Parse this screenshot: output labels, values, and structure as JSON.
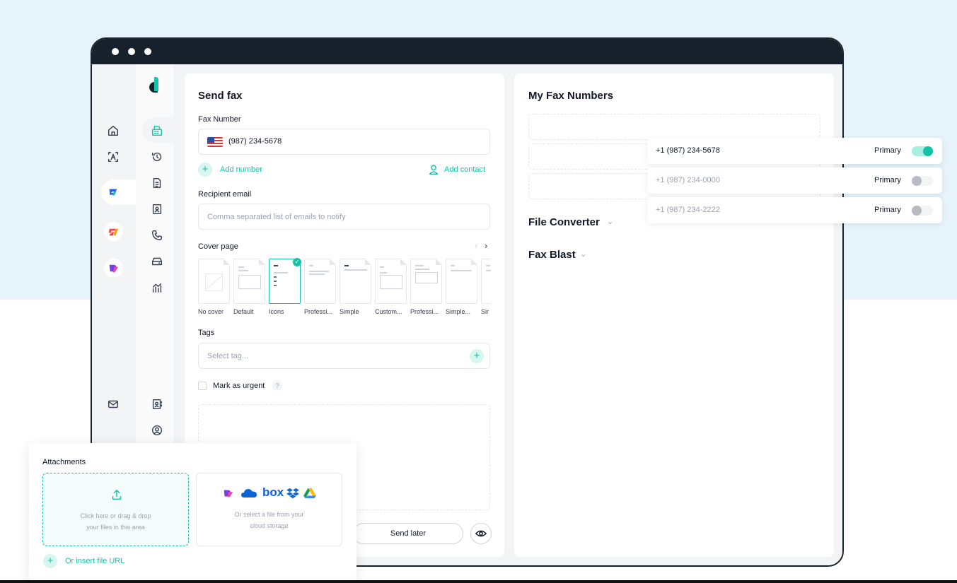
{
  "colors": {
    "accent": "#14c3a7",
    "frame": "#17212b",
    "background": "#e6f3fb"
  },
  "sidebar": {
    "rail1_icons": [
      "home-icon",
      "text-scan-icon",
      "fax-app-icon",
      "signature-app-icon",
      "docs-app-icon",
      "mail-icon"
    ],
    "rail2_icons": [
      "fax-machine-icon",
      "history-icon",
      "document-icon",
      "contact-card-icon",
      "phone-icon",
      "inbox-icon",
      "analytics-icon",
      "address-book-icon",
      "account-icon"
    ]
  },
  "send_fax": {
    "title": "Send fax",
    "fax_number_label": "Fax Number",
    "fax_number_value": "(987) 234-5678",
    "add_number": "Add number",
    "add_contact": "Add contact",
    "recipient_email_label": "Recipient email",
    "recipient_email_placeholder": "Comma separated list of emails to notify",
    "cover_page_label": "Cover page",
    "covers": [
      "No cover",
      "Default",
      "Icons",
      "Professi...",
      "Simple",
      "Custom...",
      "Professi...",
      "Simple...",
      "Sir"
    ],
    "selected_cover": "Icons",
    "tags_label": "Tags",
    "tags_placeholder": "Select tag...",
    "urgent_label": "Mark as urgent",
    "help": "?",
    "send_later": "Send later"
  },
  "fax_numbers": {
    "title": "My Fax Numbers",
    "rows": [
      {
        "number": "+1 (987) 234-5678",
        "label": "Primary",
        "on": true
      },
      {
        "number": "+1 (987) 234-0000",
        "label": "Primary",
        "on": false
      },
      {
        "number": "+1 (987) 234-2222",
        "label": "Primary",
        "on": false
      }
    ],
    "file_converter": "File Converter",
    "fax_blast": "Fax Blast"
  },
  "attachments": {
    "title": "Attachments",
    "drop_text_1": "Click here or drag & drop",
    "drop_text_2": "your files in this area",
    "cloud_text_1": "Or select a file from your",
    "cloud_text_2": "cloud storage",
    "cloud_logo_box": "box",
    "insert_url": "Or insert file URL"
  }
}
